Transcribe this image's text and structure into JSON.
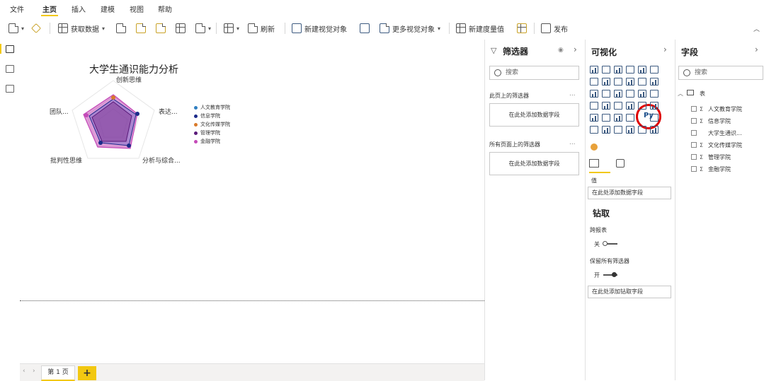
{
  "menu": [
    "文件",
    "主页",
    "插入",
    "建模",
    "视图",
    "帮助"
  ],
  "menu_active": "主页",
  "toolbar": {
    "get_data": "获取数据",
    "refresh": "刷新",
    "new_visual": "新建视觉对象",
    "more_visuals": "更多视觉对象",
    "new_measure": "新建度量值",
    "publish": "发布"
  },
  "chart": {
    "title": "大学生通识能力分析",
    "axes": [
      "创新思维",
      "表达...",
      "分析与综合...",
      "批判性思维",
      "团队..."
    ],
    "legend": [
      {
        "name": "人文教育学院",
        "color": "#2f7fc1"
      },
      {
        "name": "信息学院",
        "color": "#1b2a8a"
      },
      {
        "name": "文化传媒学院",
        "color": "#d97a2b"
      },
      {
        "name": "管理学院",
        "color": "#5a1a7a"
      },
      {
        "name": "金融学院",
        "color": "#c44ab8"
      }
    ]
  },
  "pages": {
    "tab": "第 1 页",
    "add": "+"
  },
  "filters": {
    "title": "筛选器",
    "search": "搜索",
    "this_page": "此页上的筛选器",
    "all_pages": "所有页面上的筛选器",
    "drop": "在此处添加数据字段",
    "more": "..."
  },
  "viz": {
    "title": "可视化",
    "values_label": "值",
    "values_drop": "在此处添加数据字段",
    "drill_title": "钻取",
    "cross_report": "跨报表",
    "off": "关",
    "keep_filters": "保留所有筛选器",
    "on": "开",
    "drill_drop": "在此处添加钻取字段",
    "py": "Py"
  },
  "fields": {
    "title": "字段",
    "search": "搜索",
    "table": "表",
    "items": [
      {
        "label": "人文教育学院",
        "sigma": "Σ"
      },
      {
        "label": "信息学院",
        "sigma": "Σ"
      },
      {
        "label": "大学生通识...",
        "sigma": ""
      },
      {
        "label": "文化传媒学院",
        "sigma": "Σ"
      },
      {
        "label": "管理学院",
        "sigma": "Σ"
      },
      {
        "label": "金融学院",
        "sigma": "Σ"
      }
    ]
  }
}
